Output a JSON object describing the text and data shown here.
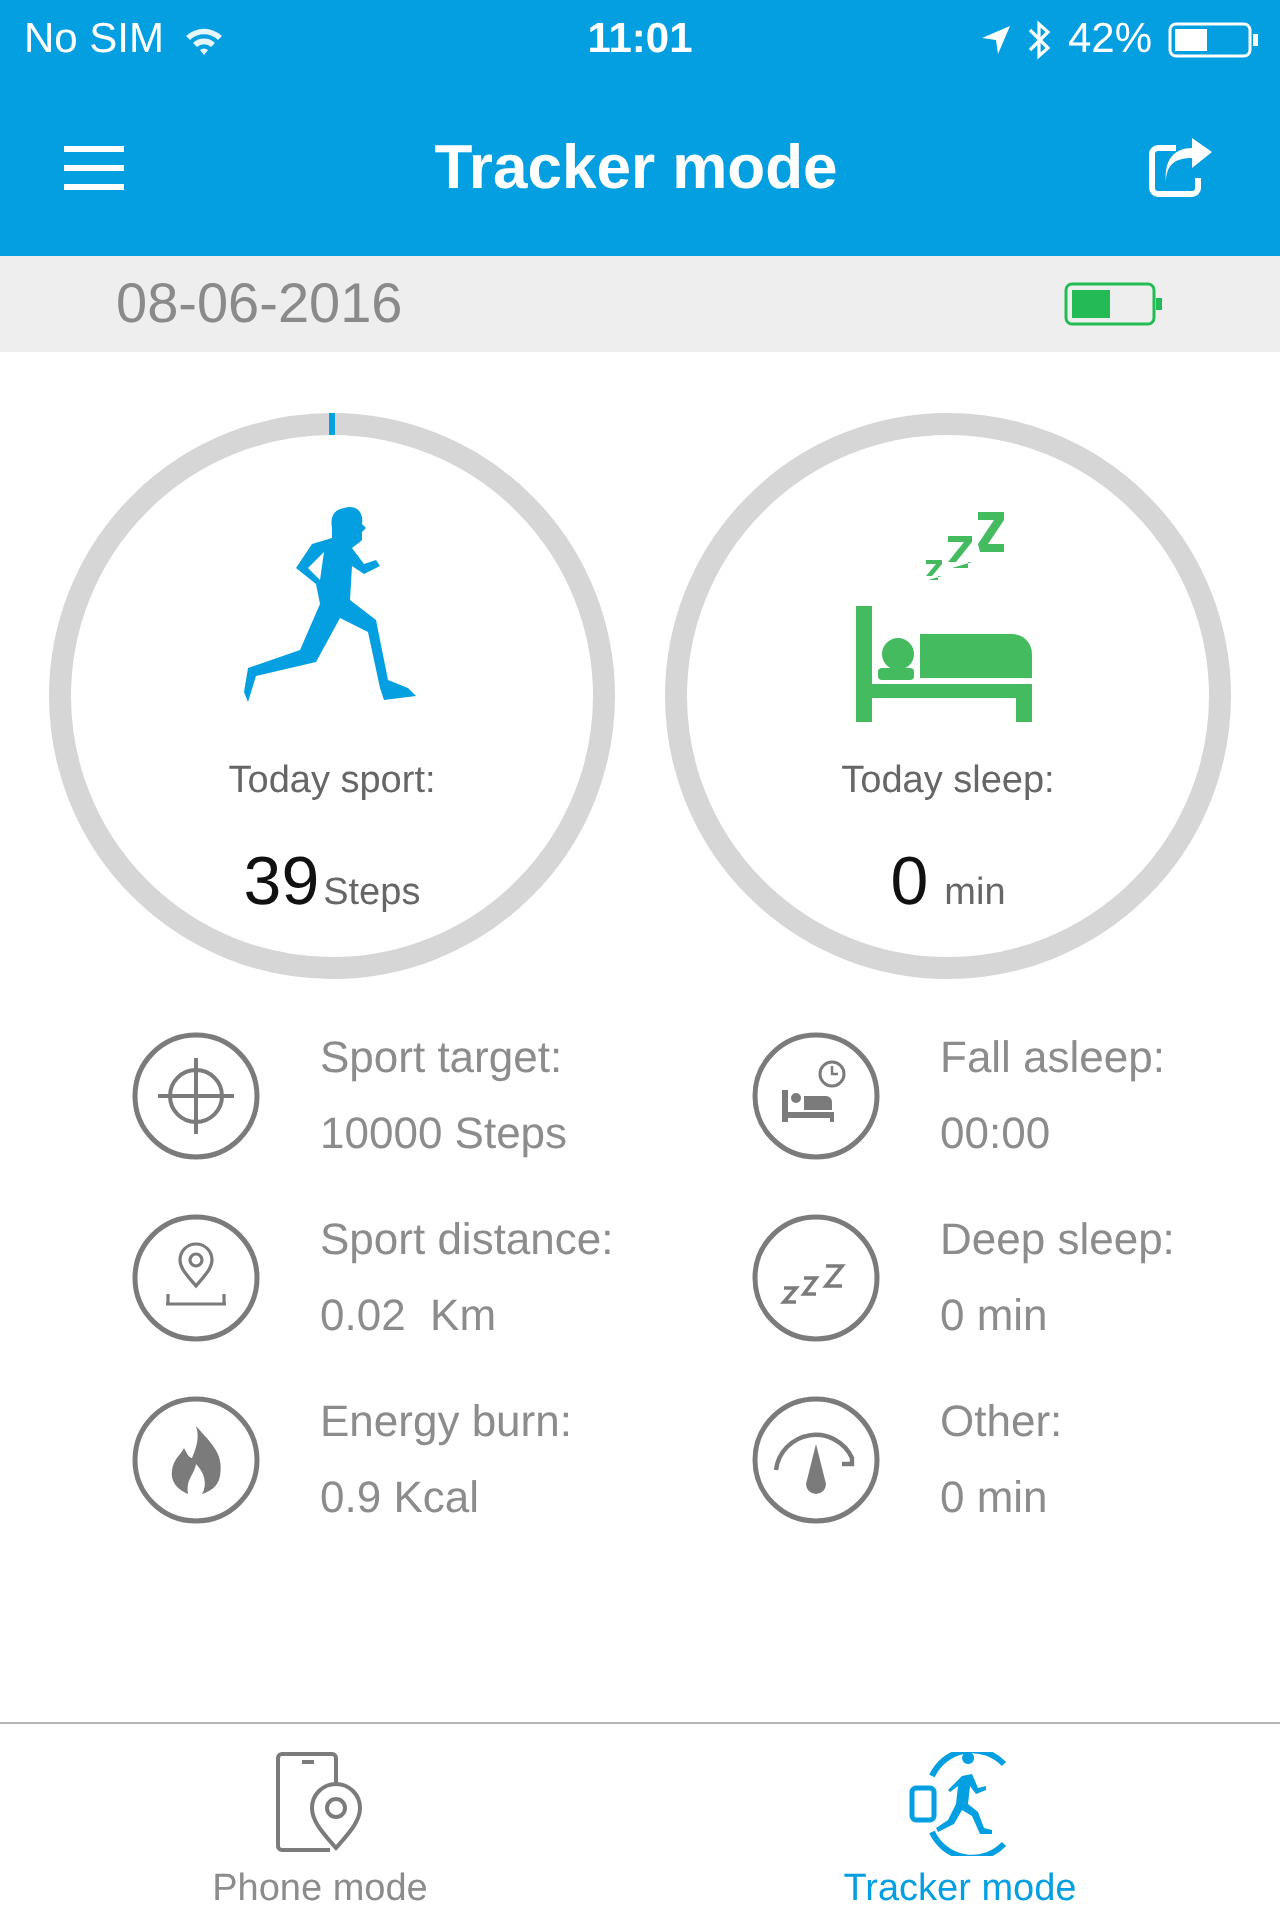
{
  "status_bar": {
    "carrier": "No SIM",
    "time": "11:01",
    "battery_percent": "42%"
  },
  "nav": {
    "title": "Tracker mode"
  },
  "date_bar": {
    "date": "08-06-2016"
  },
  "rings": [
    {
      "kind": "sport",
      "label": "Today sport:",
      "value": "39",
      "unit": "Steps"
    },
    {
      "kind": "sleep",
      "label": "Today sleep:",
      "value": "0",
      "unit": "min"
    }
  ],
  "stats": [
    {
      "kind": "target",
      "label": "Sport target:",
      "value": "10000 Steps"
    },
    {
      "kind": "fall-asleep",
      "label": "Fall asleep:",
      "value": "00:00"
    },
    {
      "kind": "distance",
      "label": "Sport distance:",
      "value": "0.02  Km"
    },
    {
      "kind": "deep-sleep",
      "label": "Deep sleep:",
      "value": "0 min"
    },
    {
      "kind": "energy",
      "label": "Energy burn:",
      "value": "0.9 Kcal"
    },
    {
      "kind": "other",
      "label": "Other:",
      "value": "0 min"
    }
  ],
  "tabs": [
    {
      "kind": "phone",
      "label": "Phone mode",
      "selected": false
    },
    {
      "kind": "tracker",
      "label": "Tracker mode",
      "selected": true
    }
  ]
}
